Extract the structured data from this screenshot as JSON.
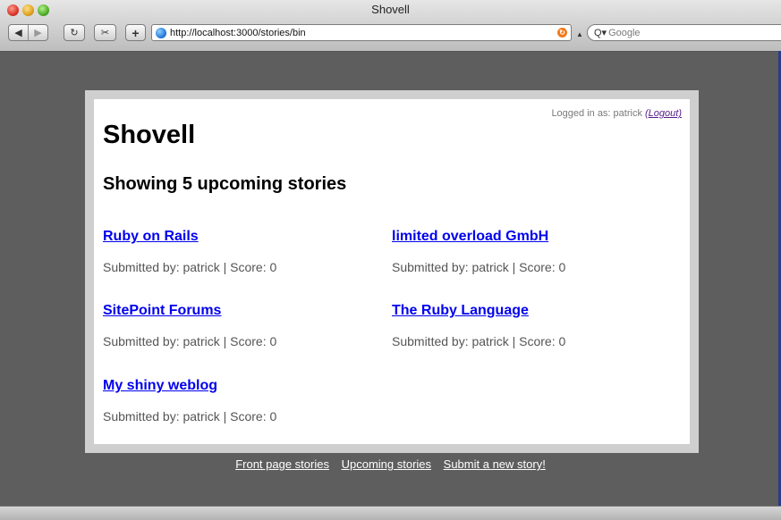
{
  "window": {
    "title": "Shovell"
  },
  "toolbar": {
    "back_icon": "back-arrow-icon",
    "forward_icon": "forward-arrow-icon",
    "reload_icon": "reload-icon",
    "snippet_icon": "webclip-icon",
    "add_icon": "plus-icon",
    "url": "http://localhost:3000/stories/bin",
    "search_placeholder": "Google"
  },
  "header": {
    "logged_in_text": "Logged in as: patrick",
    "logout_label": "(Logout)"
  },
  "page": {
    "site_title": "Shovell",
    "heading": "Showing 5 upcoming stories"
  },
  "stories": [
    {
      "title": "Ruby on Rails",
      "meta": "Submitted by: patrick | Score: 0"
    },
    {
      "title": "limited overload GmbH",
      "meta": "Submitted by: patrick | Score: 0"
    },
    {
      "title": "SitePoint Forums",
      "meta": "Submitted by: patrick | Score: 0"
    },
    {
      "title": "The Ruby Language",
      "meta": "Submitted by: patrick | Score: 0"
    },
    {
      "title": "My shiny weblog",
      "meta": "Submitted by: patrick | Score: 0"
    }
  ],
  "footer": {
    "front_page": "Front page stories",
    "upcoming": "Upcoming stories",
    "submit": "Submit a new story!"
  },
  "colors": {
    "link": "#0000ee",
    "visited_link": "#551a8b",
    "background": "#5e5e5e",
    "frame": "#cfcfcf"
  }
}
